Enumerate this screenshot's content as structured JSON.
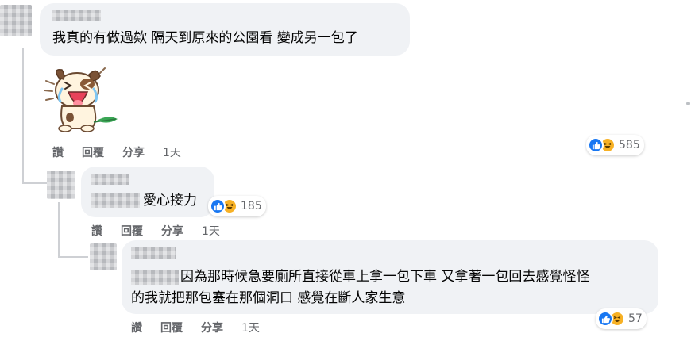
{
  "comment1": {
    "text": "我真的有做過欸 隔天到原來的公園看 變成另一包了",
    "sticker_icon": "crying-laughing-puppy-sticker-icon",
    "actions": {
      "like": "讚",
      "reply": "回覆",
      "share": "分享",
      "time": "1天"
    },
    "reactions": {
      "icons": [
        "like-icon",
        "haha-icon"
      ],
      "count": "585"
    }
  },
  "reply1": {
    "text": "愛心接力",
    "actions": {
      "like": "讚",
      "reply": "回覆",
      "share": "分享",
      "time": "1天"
    },
    "reactions": {
      "icons": [
        "like-icon",
        "haha-icon"
      ],
      "count": "185"
    }
  },
  "reply2": {
    "line1": "因為那時候急要廁所直接從車上拿一包下車 又拿著一包回去感覺怪怪",
    "line2": "的我就把那包塞在那個洞口 感覺在斷人家生意",
    "actions": {
      "like": "讚",
      "reply": "回覆",
      "share": "分享",
      "time": "1天"
    },
    "reactions": {
      "icons": [
        "like-icon",
        "haha-icon"
      ],
      "count": "57"
    }
  },
  "colors": {
    "bubble": "#f0f2f5",
    "secondary_text": "#65676b",
    "like_blue": "#1877f2",
    "haha_yellow": "#f7b125",
    "thread_line": "#ced0d4"
  }
}
